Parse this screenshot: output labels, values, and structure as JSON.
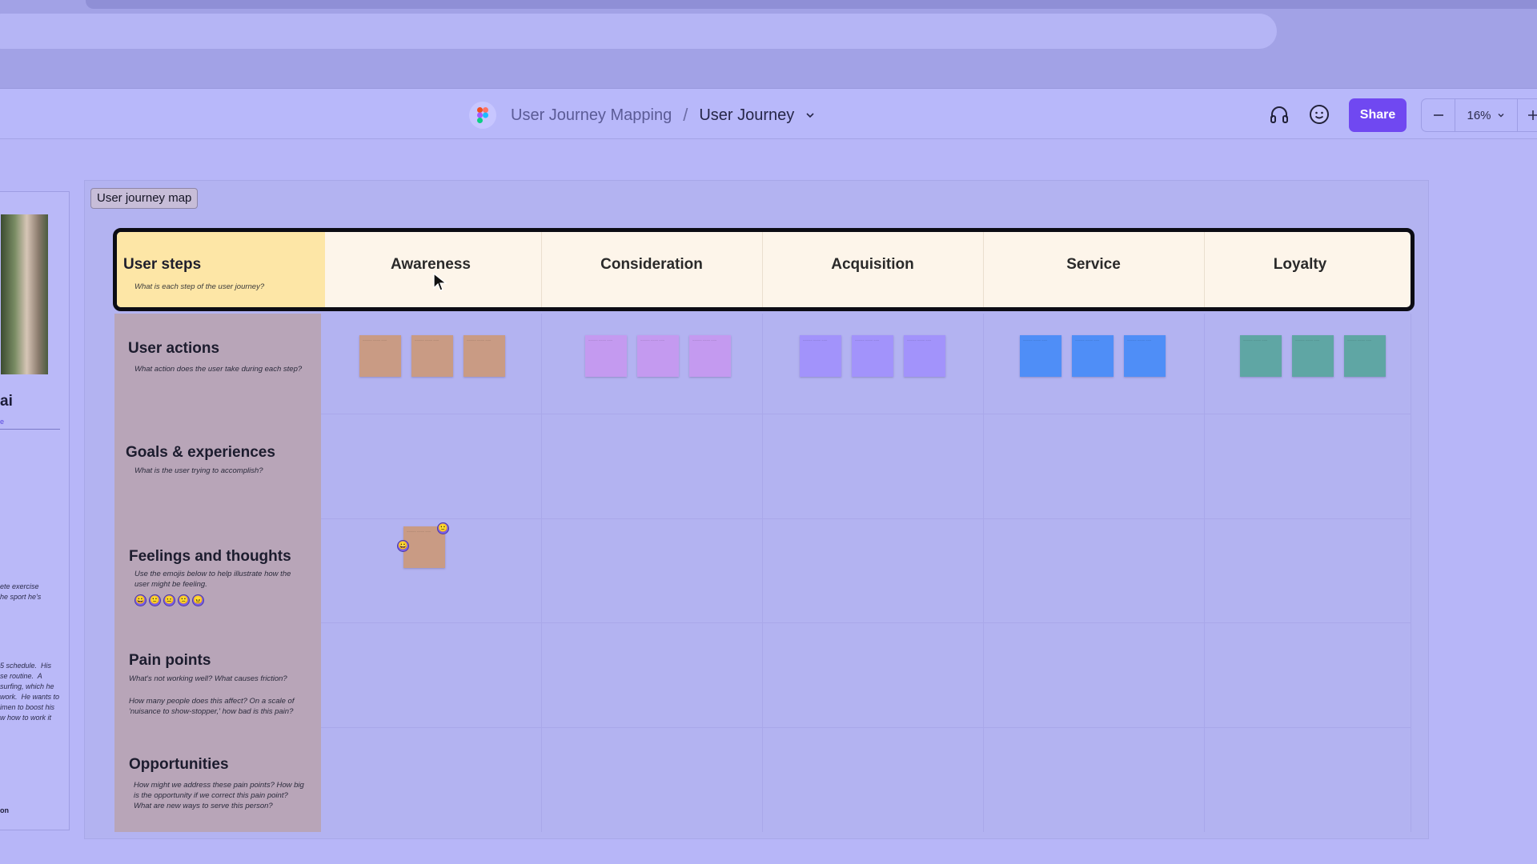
{
  "toolbar": {
    "breadcrumb_parent": "User Journey Mapping",
    "breadcrumb_separator": "/",
    "breadcrumb_current": "User Journey",
    "share_label": "Share",
    "zoom_level": "16%",
    "icons": [
      "figma-logo-icon",
      "headphones-icon",
      "smiley-icon",
      "minus-icon",
      "chevron-down-icon",
      "plus-icon"
    ],
    "accent_color": "#7048f1"
  },
  "board": {
    "frame_label": "User journey map",
    "steps_label": {
      "title": "User steps",
      "subtitle": "What is each step of the user journey?"
    },
    "steps": [
      "Awareness",
      "Consideration",
      "Acquisition",
      "Service",
      "Loyalty"
    ],
    "rows": [
      {
        "title": "User actions",
        "subtitle": "What action does the user take during each step?"
      },
      {
        "title": "Goals & experiences",
        "subtitle": "What is the user trying to accomplish?"
      },
      {
        "title": "Feelings and thoughts",
        "subtitle": "Use the emojis below to help illustrate how the user might be feeling."
      },
      {
        "title": "Pain points",
        "subtitle": "What's not working well? What causes friction?",
        "subtitle2": "How many people does this affect? On a scale of 'nuisance to show-stopper,' how bad is this pain?"
      },
      {
        "title": "Opportunities",
        "subtitle": "How might we address these pain points? How big is the opportunity if we correct this pain point? What are new ways to serve this person?"
      }
    ],
    "sticky_colors": [
      "#c99b84",
      "#c49af0",
      "#a293fb",
      "#4f8ef7",
      "#5fa6a4"
    ],
    "emoji_faces": [
      "😀",
      "🙂",
      "😐",
      "🙁",
      "😠"
    ]
  },
  "persona": {
    "name_fragment": "ai",
    "text_1": "ete exercise\nhe sport he's",
    "text_2": "5 schedule.  His\nse routine.  A\nsurfing, which he\nwork.  He wants to\nimen to boost his\nw how to work it",
    "bold_fragment": "on"
  }
}
